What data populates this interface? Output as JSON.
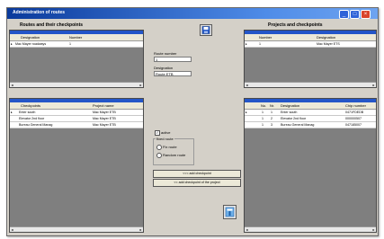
{
  "window": {
    "title": "Administration of routes"
  },
  "left": {
    "header": "Routes and their checkpoints",
    "top_grid": {
      "columns": [
        "Designation",
        "Number"
      ],
      "rows": [
        {
          "indicator": "▸",
          "designation": "Mac Mayer roadways",
          "number": "1"
        }
      ]
    },
    "bottom_grid": {
      "columns": [
        "Checkpoints",
        "Project name"
      ],
      "rows": [
        {
          "indicator": "▸",
          "checkpoint": "Enter south",
          "project": "Mac Mayer ETB"
        },
        {
          "indicator": "",
          "checkpoint": "Elevator 2nd floor",
          "project": "Mac Mayer ETB"
        },
        {
          "indicator": "",
          "checkpoint": "Bureau General Manag",
          "project": "Mac Mayer ETB"
        }
      ]
    }
  },
  "middle": {
    "route_number_label": "Route number",
    "route_number_value": "1",
    "designation_label": "Designation",
    "designation_value": "Route ETB",
    "active_label": "active",
    "active_checked": "✓",
    "fixed_route_label": "fixed route",
    "fix_route_label": "Fix route",
    "random_route_label": "Random route",
    "add_checkpoint_label": "<<< add checkpoint",
    "add_checkpoint_project_label": "<< add checkpoint of the project"
  },
  "right": {
    "header": "Projects and checkpoints",
    "top_grid": {
      "columns": [
        "Number",
        "Designation"
      ],
      "rows": [
        {
          "indicator": "▸",
          "number": "1",
          "designation": "Mac Mayer ETS"
        }
      ]
    },
    "bottom_grid": {
      "columns": [
        "No.",
        "Nr.",
        "Designation",
        "Chip number"
      ],
      "rows": [
        {
          "indicator": "▸",
          "no": "1",
          "nr": "1",
          "designation": "Enter south",
          "chip": "0471FDEDB"
        },
        {
          "indicator": "",
          "no": "1",
          "nr": "2",
          "designation": "Elevator 2nd floor",
          "chip": "000000507"
        },
        {
          "indicator": "",
          "no": "1",
          "nr": "3",
          "designation": "Bureau General Manag",
          "chip": "047185007"
        }
      ]
    }
  }
}
